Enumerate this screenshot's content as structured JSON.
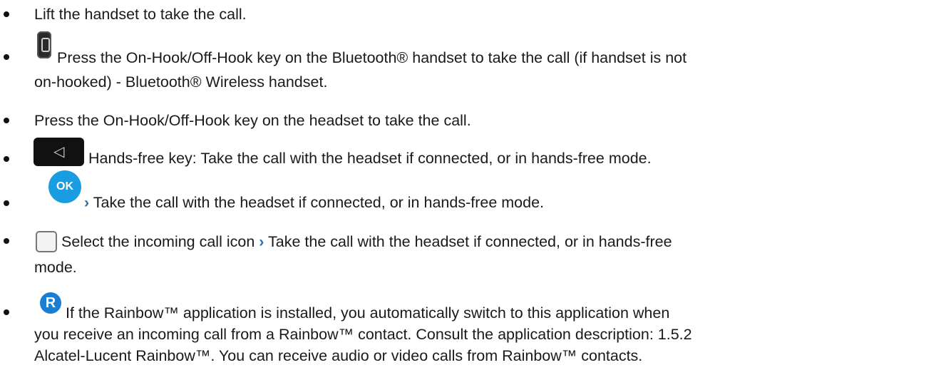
{
  "items": [
    {
      "icon": "",
      "lines": [
        "Lift the handset to take the call."
      ]
    },
    {
      "icon": "bluetooth-handset-icon",
      "lines": [
        "Press the On-Hook/Off-Hook key on the Bluetooth® handset to take the call (if handset is not",
        "on-hooked) - Bluetooth® Wireless handset."
      ]
    },
    {
      "icon": "",
      "lines": [
        "Press the On-Hook/Off-Hook key on the headset to take the call."
      ]
    },
    {
      "icon": "hands-free-key-icon",
      "lines": [
        "Hands-free key: Take the call with the headset if connected, or in hands-free mode."
      ]
    },
    {
      "icon": "ok-key-icon",
      "ok_label": "OK",
      "arrow": "›",
      "lines": [
        "Take the call with the headset if connected, or in hands-free mode."
      ]
    },
    {
      "icon": "incoming-call-icon",
      "line1_part1": "Select the incoming call icon",
      "arrow": "›",
      "line1_part2": "Take the call with the headset if connected, or in hands-free",
      "lines": [
        "mode."
      ]
    },
    {
      "icon": "rainbow-app-icon",
      "rainbow_label": "R",
      "lines": [
        "If the Rainbow™ application is installed, you automatically switch to this application when",
        "you receive an incoming call from a Rainbow™ contact. Consult the application description: 1.5.2",
        "Alcatel-Lucent Rainbow™. You can receive audio or video calls from Rainbow™ contacts."
      ]
    }
  ]
}
